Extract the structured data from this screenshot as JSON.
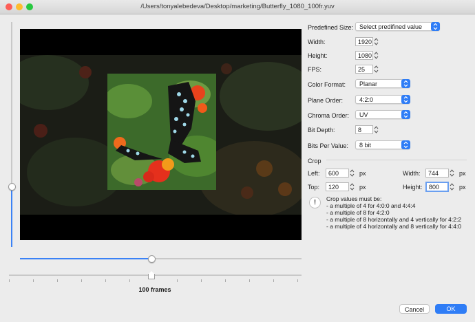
{
  "window": {
    "title": "/Users/tonyalebedeva/Desktop/marketing/Butterfly_1080_100fr.yuv",
    "traffic_lights": [
      "#fd5e57",
      "#febc2e",
      "#28c840"
    ]
  },
  "timeline": {
    "frames_label": "100 frames",
    "position": 0.5
  },
  "zoom_slider": {
    "level": 0.28
  },
  "form": {
    "predefined_size": {
      "label": "Predefined Size:",
      "value": "Select predifined value"
    },
    "width": {
      "label": "Width:",
      "value": "1920"
    },
    "height": {
      "label": "Height:",
      "value": "1080"
    },
    "fps": {
      "label": "FPS:",
      "value": "25"
    },
    "color_format": {
      "label": "Color Format:",
      "value": "Planar"
    },
    "plane_order": {
      "label": "Plane Order:",
      "value": "4:2:0"
    },
    "chroma_order": {
      "label": "Chroma Order:",
      "value": "UV"
    },
    "bit_depth": {
      "label": "Bit Depth:",
      "value": "8"
    },
    "bits_per_value": {
      "label": "Bits Per Value:",
      "value": "8 bit"
    }
  },
  "crop": {
    "section_label": "Crop",
    "left": {
      "label": "Left:",
      "value": "600",
      "unit": "px"
    },
    "top": {
      "label": "Top:",
      "value": "120",
      "unit": "px"
    },
    "width": {
      "label": "Width:",
      "value": "744",
      "unit": "px"
    },
    "height": {
      "label": "Height:",
      "value": "800",
      "unit": "px"
    },
    "warning_icon": "!",
    "note_title": "Crop values must be:",
    "note_lines": [
      "- a multiple of 4 for 4:0:0 and 4:4:4",
      "- a multiple of 8 for 4:2:0",
      "- a multiple of 8 horizontally and 4 vertically for 4:2:2",
      "- a multiple of 4 horizontally and 8 vertically for 4:4:0"
    ]
  },
  "buttons": {
    "cancel": "Cancel",
    "ok": "OK"
  },
  "colors": {
    "accent": "#2f7df6",
    "focus_ring": "#6a9ff0"
  }
}
